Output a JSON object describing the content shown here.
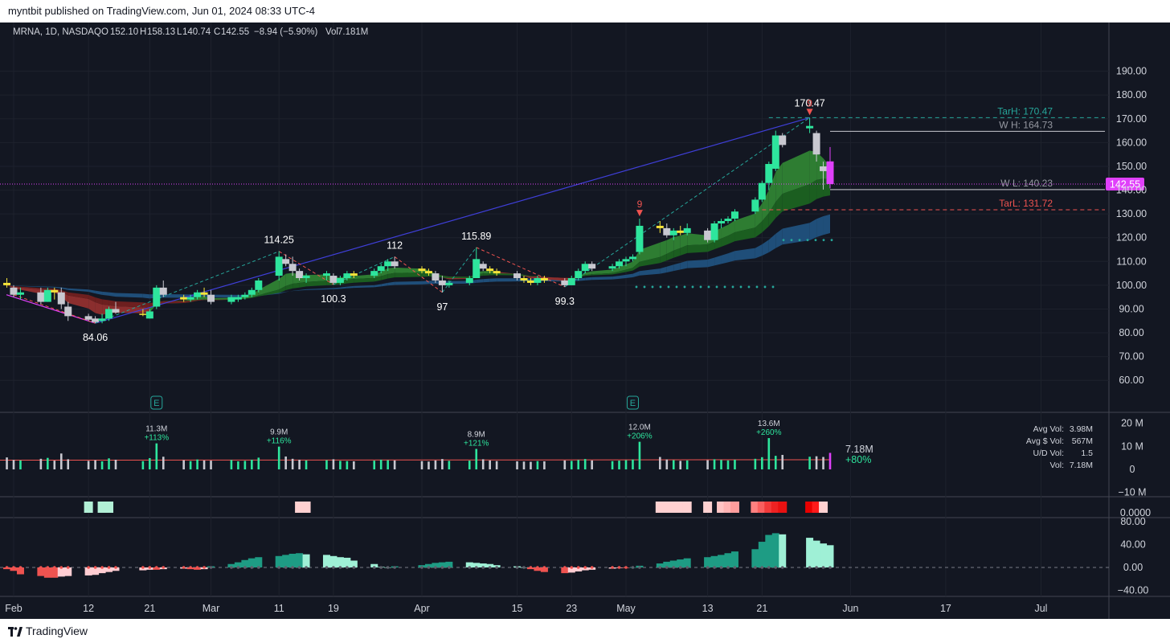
{
  "header": {
    "published": "myntbit published on TradingView.com, Jun 01, 2024 08:33 UTC-4"
  },
  "legend": {
    "symbol": "MRNA, 1D, NASDAQ",
    "o_label": "O",
    "o_value": "152.10",
    "h_label": "H",
    "h_value": "158.13",
    "l_label": "L",
    "l_value": "140.74",
    "c_label": "C",
    "c_value": "142.55",
    "change": "−8.94 (−5.90%)",
    "vol_label": "Vol",
    "vol_value": "7.181M"
  },
  "footer": {
    "brand": "TradingView"
  },
  "colors": {
    "bg": "#131722",
    "up": "#2ee59d",
    "down": "#c8c8d0",
    "yellow": "#f5e43a",
    "magenta": "#e040fb",
    "grid": "#1e222d",
    "axis_text": "#d1d4dc",
    "target_high": "#26a69a",
    "target_low": "#ef5350",
    "trend": "#3f3fd9"
  },
  "chart_data": [
    {
      "type": "candlestick",
      "title": "MRNA, 1D, NASDAQ",
      "ylim": [
        55,
        198
      ],
      "y_ticks": [
        "190.00",
        "180.00",
        "170.00",
        "160.00",
        "150.00",
        "140.00",
        "130.00",
        "120.00",
        "110.00",
        "100.00",
        "90.00",
        "80.00",
        "70.00",
        "60.00"
      ],
      "x_ticks": [
        "Feb",
        "12",
        "21",
        "Mar",
        "11",
        "19",
        "Apr",
        "15",
        "23",
        "May",
        "13",
        "21",
        "Jun",
        "17",
        "Jul"
      ],
      "x_tick_dates": [
        "2024-02-01",
        "2024-02-12",
        "2024-02-21",
        "2024-03-01",
        "2024-03-11",
        "2024-03-19",
        "2024-04-01",
        "2024-04-15",
        "2024-04-23",
        "2024-05-01",
        "2024-05-13",
        "2024-05-21",
        "2024-06-03",
        "2024-06-17",
        "2024-07-01"
      ],
      "candles": [
        [
          "2024-01-31",
          101,
          103,
          99,
          100
        ],
        [
          "2024-02-01",
          99,
          100,
          95,
          96
        ],
        [
          "2024-02-02",
          96,
          99,
          94,
          97
        ],
        [
          "2024-02-05",
          97,
          99,
          92,
          93
        ],
        [
          "2024-02-06",
          93,
          99,
          93,
          98
        ],
        [
          "2024-02-07",
          98,
          99,
          94,
          97
        ],
        [
          "2024-02-08",
          97,
          99,
          90,
          92
        ],
        [
          "2024-02-09",
          91,
          93,
          85,
          87
        ],
        [
          "2024-02-12",
          87,
          88,
          85,
          85.5
        ],
        [
          "2024-02-13",
          86,
          87,
          84.06,
          84.5
        ],
        [
          "2024-02-14",
          85,
          88,
          84,
          86
        ],
        [
          "2024-02-15",
          86,
          91,
          85,
          90
        ],
        [
          "2024-02-16",
          90,
          93,
          88,
          88.5
        ],
        [
          "2024-02-20",
          88,
          90,
          87,
          88
        ],
        [
          "2024-02-21",
          86,
          90,
          86,
          89
        ],
        [
          "2024-02-22",
          91,
          100,
          90,
          99
        ],
        [
          "2024-02-23",
          99,
          102,
          95,
          96
        ],
        [
          "2024-02-26",
          95,
          96,
          93,
          94
        ],
        [
          "2024-02-27",
          94,
          96,
          93,
          95
        ],
        [
          "2024-02-28",
          95,
          98,
          94,
          97
        ],
        [
          "2024-02-29",
          97,
          99,
          95,
          96
        ],
        [
          "2024-03-01",
          96,
          98,
          92,
          93
        ],
        [
          "2024-03-04",
          93,
          96,
          92,
          95
        ],
        [
          "2024-03-05",
          94,
          96,
          93,
          95
        ],
        [
          "2024-03-06",
          95,
          97,
          94,
          96
        ],
        [
          "2024-03-07",
          96,
          99,
          95,
          98
        ],
        [
          "2024-03-08",
          98,
          103,
          97,
          102
        ],
        [
          "2024-03-11",
          104,
          114.25,
          102,
          112
        ],
        [
          "2024-03-12",
          111,
          113,
          108,
          109
        ],
        [
          "2024-03-13",
          109,
          112,
          104,
          106
        ],
        [
          "2024-03-14",
          106,
          107,
          102,
          103
        ],
        [
          "2024-03-15",
          103,
          105,
          101,
          104
        ],
        [
          "2024-03-18",
          104,
          106,
          102,
          105
        ],
        [
          "2024-03-19",
          104,
          105,
          100.3,
          101
        ],
        [
          "2024-03-20",
          101,
          104,
          100,
          103
        ],
        [
          "2024-03-21",
          103,
          106,
          102,
          105
        ],
        [
          "2024-03-22",
          105,
          106,
          103,
          104
        ],
        [
          "2024-03-25",
          104,
          107,
          103,
          106
        ],
        [
          "2024-03-26",
          106,
          109,
          105,
          108
        ],
        [
          "2024-03-27",
          108,
          111,
          106,
          110
        ],
        [
          "2024-03-28",
          110,
          112,
          107,
          108
        ],
        [
          "2024-04-01",
          107,
          108,
          105,
          106
        ],
        [
          "2024-04-02",
          106,
          107,
          104,
          105
        ],
        [
          "2024-04-03",
          105,
          106,
          101,
          102
        ],
        [
          "2024-04-04",
          102,
          104,
          97,
          100
        ],
        [
          "2024-04-05",
          100,
          102,
          99,
          101
        ],
        [
          "2024-04-08",
          101,
          104,
          100,
          103
        ],
        [
          "2024-04-09",
          103,
          115.89,
          103,
          111
        ],
        [
          "2024-04-10",
          109,
          110,
          106,
          107
        ],
        [
          "2024-04-11",
          107,
          108,
          105,
          106
        ],
        [
          "2024-04-12",
          106,
          107,
          104,
          105
        ],
        [
          "2024-04-15",
          105,
          106,
          102,
          103
        ],
        [
          "2024-04-16",
          103,
          104,
          101,
          102
        ],
        [
          "2024-04-17",
          102,
          103,
          100,
          101
        ],
        [
          "2024-04-18",
          101,
          104,
          100,
          103
        ],
        [
          "2024-04-19",
          103,
          104,
          101,
          102
        ],
        [
          "2024-04-22",
          102,
          103,
          99.3,
          100
        ],
        [
          "2024-04-23",
          100,
          104,
          100,
          103
        ],
        [
          "2024-04-24",
          103,
          107,
          102,
          106
        ],
        [
          "2024-04-25",
          106,
          110,
          105,
          109
        ],
        [
          "2024-04-26",
          109,
          110,
          106,
          107
        ],
        [
          "2024-04-29",
          107,
          109,
          106,
          108
        ],
        [
          "2024-04-30",
          108,
          111,
          107,
          110
        ],
        [
          "2024-05-01",
          110,
          112,
          108,
          111
        ],
        [
          "2024-05-02",
          111,
          113,
          110,
          112
        ],
        [
          "2024-05-03",
          114,
          128,
          113,
          125
        ],
        [
          "2024-05-06",
          125,
          127,
          122,
          124
        ],
        [
          "2024-05-07",
          124,
          126,
          120,
          121
        ],
        [
          "2024-05-08",
          121,
          124,
          119,
          123
        ],
        [
          "2024-05-09",
          123,
          125,
          121,
          122
        ],
        [
          "2024-05-10",
          122,
          126,
          121,
          124
        ],
        [
          "2024-05-13",
          123,
          124,
          118,
          119
        ],
        [
          "2024-05-14",
          119,
          127,
          118,
          126
        ],
        [
          "2024-05-15",
          126,
          128,
          124,
          127
        ],
        [
          "2024-05-16",
          127,
          129,
          126,
          128
        ],
        [
          "2024-05-17",
          128,
          132,
          127,
          131
        ],
        [
          "2024-05-20",
          131,
          137,
          130,
          136
        ],
        [
          "2024-05-21",
          136,
          144,
          135,
          143
        ],
        [
          "2024-05-22",
          143,
          152,
          140,
          151
        ],
        [
          "2024-05-23",
          149,
          165,
          148,
          163
        ],
        [
          "2024-05-24",
          163,
          164,
          158,
          159
        ],
        [
          "2024-05-28",
          166,
          170.47,
          164,
          167
        ],
        [
          "2024-05-29",
          164,
          165,
          152,
          155
        ],
        [
          "2024-05-30",
          150,
          152,
          140.23,
          148
        ],
        [
          "2024-05-31",
          152.1,
          158.13,
          140.74,
          142.55
        ]
      ],
      "labels": [
        {
          "date": "2024-02-13",
          "price": 84.06,
          "text": "84.06",
          "pos": "below"
        },
        {
          "date": "2024-03-11",
          "price": 114.25,
          "text": "114.25",
          "pos": "above"
        },
        {
          "date": "2024-03-19",
          "price": 100.3,
          "text": "100.3",
          "pos": "below"
        },
        {
          "date": "2024-03-28",
          "price": 112,
          "text": "112",
          "pos": "above"
        },
        {
          "date": "2024-04-04",
          "price": 97,
          "text": "97",
          "pos": "below"
        },
        {
          "date": "2024-04-09",
          "price": 115.89,
          "text": "115.89",
          "pos": "above"
        },
        {
          "date": "2024-04-22",
          "price": 99.3,
          "text": "99.3",
          "pos": "below"
        },
        {
          "date": "2024-05-28",
          "price": 170.47,
          "text": "170.47",
          "pos": "top"
        }
      ],
      "signals": [
        {
          "date": "2024-05-03",
          "price": 128,
          "text": "9"
        },
        {
          "date": "2024-05-28",
          "price": 170.47,
          "text": "9"
        }
      ],
      "levels": [
        {
          "name": "TarH",
          "text": "TarH: 170.47",
          "value": 170.47,
          "style": "dashed-teal"
        },
        {
          "name": "W H",
          "text": "W H: 164.73",
          "value": 164.73,
          "style": "solid-white"
        },
        {
          "name": "W L",
          "text": "W L: 140.23",
          "value": 140.23,
          "style": "solid-white"
        },
        {
          "name": "TarL",
          "text": "TarL: 131.72",
          "value": 131.72,
          "style": "dashed-red"
        }
      ],
      "last_price": {
        "value": 142.55,
        "text": "142.55"
      },
      "earnings_markers": [
        {
          "date": "2024-02-22",
          "text": "E"
        },
        {
          "date": "2024-05-02",
          "text": "E"
        }
      ]
    },
    {
      "type": "bar",
      "title": "Volume",
      "y_ticks": [
        "20 M",
        "10 M",
        "0",
        "−10 M"
      ],
      "values_m": [
        5.2,
        4.1,
        3.9,
        4.6,
        5.0,
        3.8,
        6.9,
        4.4,
        3.7,
        4.0,
        3.5,
        4.8,
        4.2,
        3.6,
        4.9,
        11.3,
        5.5,
        4.0,
        3.6,
        4.3,
        3.9,
        3.8,
        4.1,
        3.5,
        3.7,
        4.2,
        5.1,
        9.9,
        5.6,
        4.6,
        4.2,
        3.9,
        4.0,
        4.4,
        3.7,
        3.6,
        3.5,
        3.8,
        4.2,
        4.0,
        3.9,
        3.6,
        3.4,
        3.9,
        4.5,
        3.7,
        3.8,
        8.9,
        4.4,
        3.9,
        3.6,
        3.5,
        3.4,
        3.3,
        3.6,
        3.5,
        3.9,
        3.7,
        4.1,
        4.5,
        3.9,
        3.6,
        3.8,
        4.0,
        4.3,
        12.0,
        5.4,
        4.3,
        4.0,
        3.7,
        3.9,
        4.0,
        4.4,
        4.1,
        3.9,
        4.2,
        4.6,
        5.3,
        13.6,
        5.9,
        6.3,
        5.5,
        5.7,
        5.4,
        7.18
      ],
      "annotations": [
        {
          "index": 15,
          "vol": "11.3M",
          "pct": "+113%"
        },
        {
          "index": 27,
          "vol": "9.9M",
          "pct": "+116%"
        },
        {
          "index": 47,
          "vol": "8.9M",
          "pct": "+121%"
        },
        {
          "index": 65,
          "vol": "12.0M",
          "pct": "+206%"
        },
        {
          "index": 78,
          "vol": "13.6M",
          "pct": "+260%"
        }
      ],
      "last": {
        "vol": "7.18M",
        "pct": "+80%"
      },
      "stats": [
        {
          "label": "Avg Vol:",
          "value": "3.98M"
        },
        {
          "label": "Avg $ Vol:",
          "value": "567M"
        },
        {
          "label": "U/D Vol:",
          "value": "1.5"
        },
        {
          "label": "Vol:",
          "value": "7.18M"
        }
      ]
    },
    {
      "type": "heatmap",
      "title": "Signal boxes",
      "y_ticks": [
        "0.0000"
      ],
      "cells": [
        {
          "index": 8,
          "color": "#b2f0d6"
        },
        {
          "index": 10,
          "color": "#b2f0d6"
        },
        {
          "index": 11,
          "color": "#b2f0d6"
        },
        {
          "index": 30,
          "color": "#ffd1d1"
        },
        {
          "index": 31,
          "color": "#ffd1d1"
        },
        {
          "index": 66,
          "color": "#ffd1d1"
        },
        {
          "index": 67,
          "color": "#ffd1d1"
        },
        {
          "index": 68,
          "color": "#ffd1d1"
        },
        {
          "index": 69,
          "color": "#ffd1d1"
        },
        {
          "index": 70,
          "color": "#ffd1d1"
        },
        {
          "index": 71,
          "color": "#ffd1d1"
        },
        {
          "index": 73,
          "color": "#ffc4c4"
        },
        {
          "index": 74,
          "color": "#ffb3b3"
        },
        {
          "index": 75,
          "color": "#ff9d9d"
        },
        {
          "index": 76,
          "color": "#ff8080"
        },
        {
          "index": 77,
          "color": "#f95f5f"
        },
        {
          "index": 78,
          "color": "#f23a3a"
        },
        {
          "index": 79,
          "color": "#ee2222"
        },
        {
          "index": 80,
          "color": "#e81111"
        },
        {
          "index": 81,
          "color": "#e80000"
        },
        {
          "index": 82,
          "color": "#ff1a1a"
        },
        {
          "index": 83,
          "color": "#ffd1d1"
        }
      ]
    },
    {
      "type": "bar",
      "title": "Histogram oscillator",
      "ylim": [
        -45,
        85
      ],
      "y_ticks": [
        "80.00",
        "40.00",
        "0.00",
        "−40.00"
      ],
      "values": [
        12,
        8,
        3,
        1,
        0,
        -1,
        -3,
        -6,
        -12,
        -15,
        -18,
        -18,
        -16,
        -15,
        -14,
        -13,
        -10,
        -8,
        -6,
        -5,
        -4,
        -4,
        -3,
        -2,
        -3,
        -4,
        -3,
        2,
        6,
        9,
        13,
        16,
        18,
        20,
        22,
        24,
        25,
        23,
        22,
        20,
        18,
        17,
        12,
        6,
        1,
        0,
        2,
        4,
        6,
        8,
        9,
        10,
        9,
        8,
        7,
        6,
        4,
        2,
        0,
        -3,
        -6,
        -8,
        -10,
        -9,
        -7,
        -5,
        -4,
        -2,
        -1,
        -1,
        0,
        3,
        7,
        10,
        12,
        14,
        16,
        18,
        20,
        22,
        25,
        28,
        32,
        45,
        57,
        60,
        58,
        52,
        47,
        42,
        39
      ]
    }
  ]
}
